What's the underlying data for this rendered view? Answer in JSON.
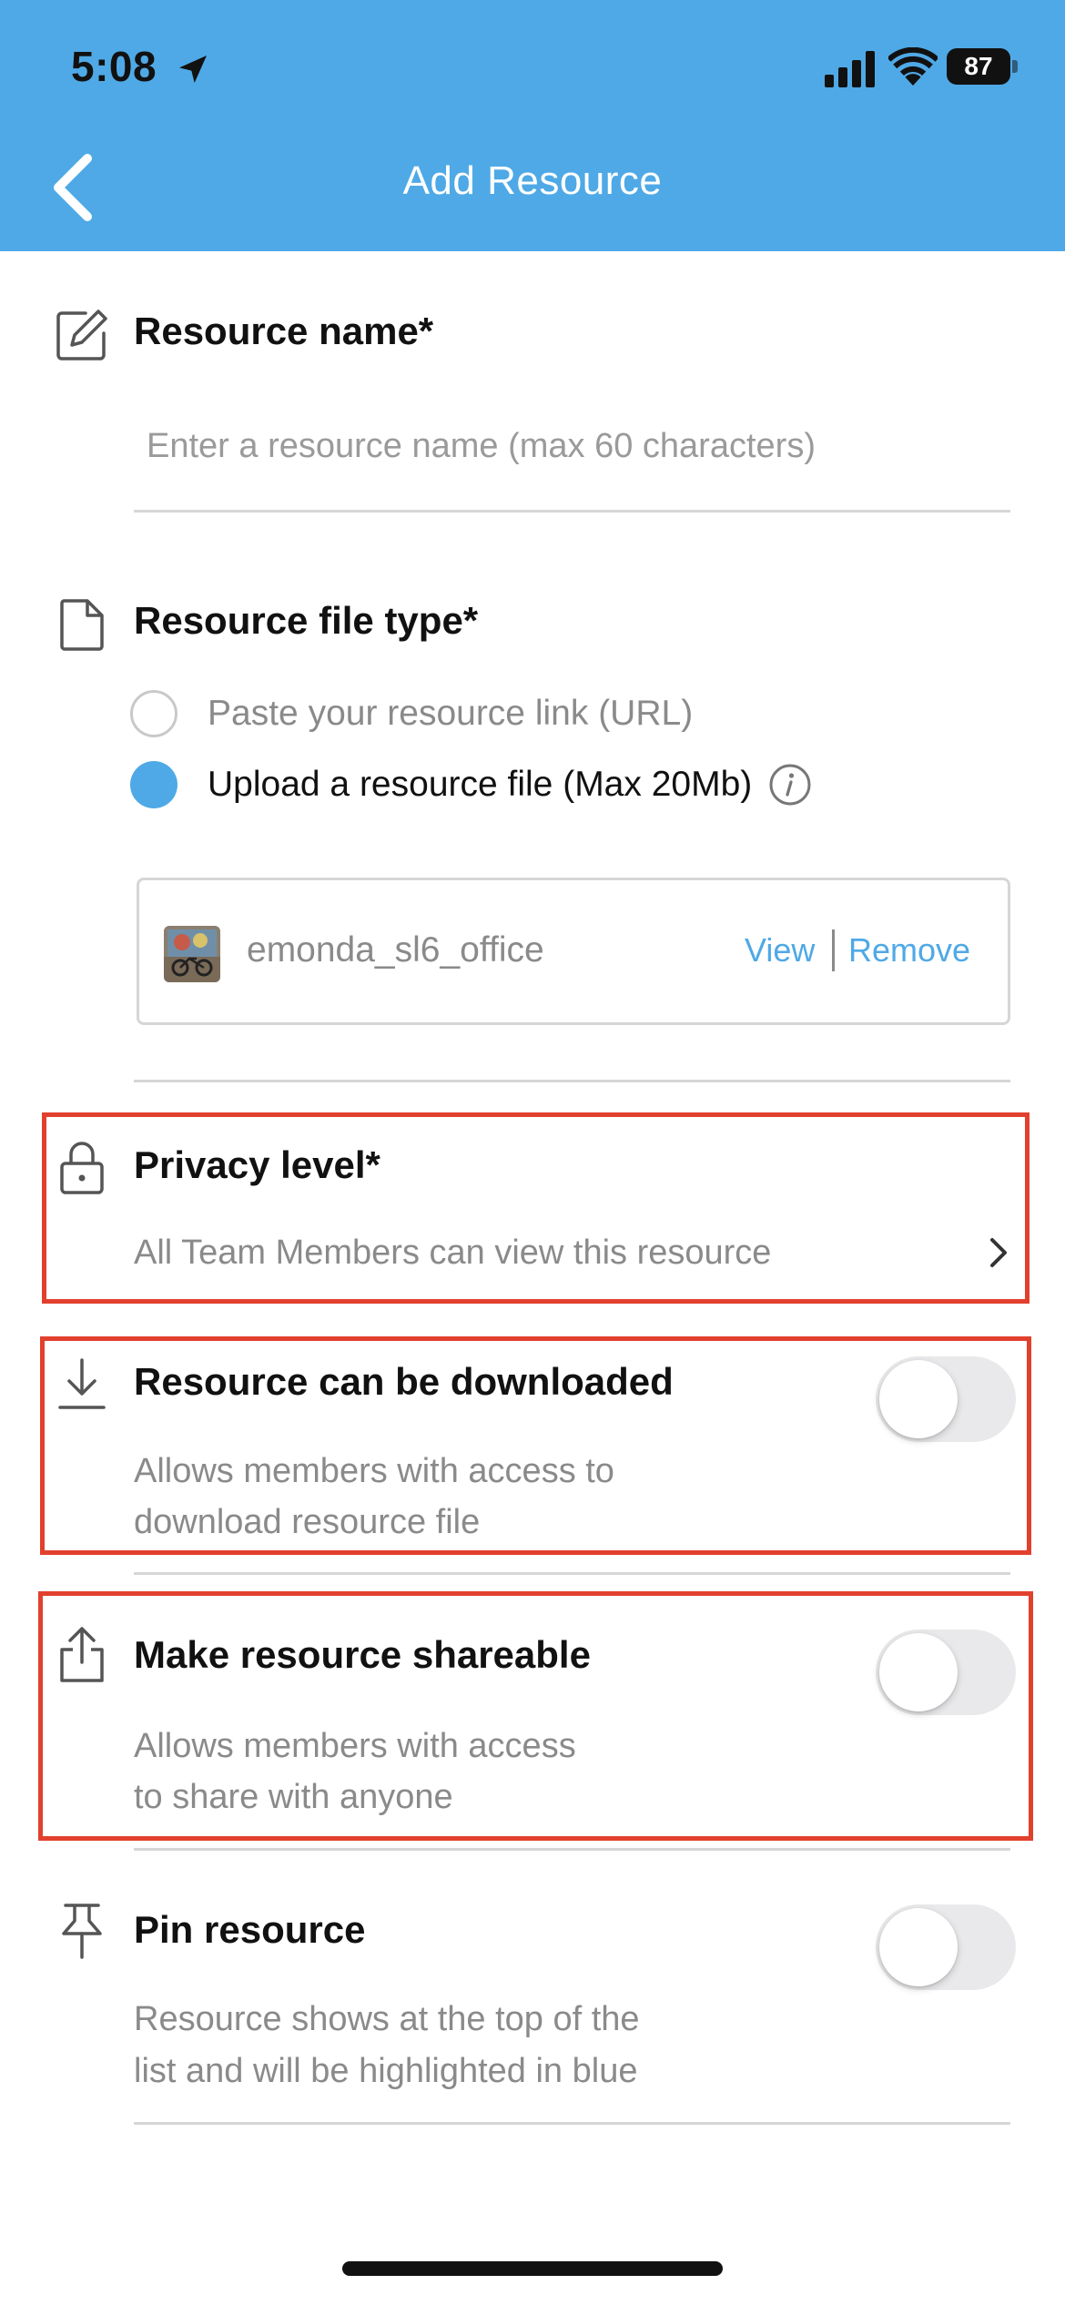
{
  "status_bar": {
    "time": "5:08",
    "battery": "87",
    "icons": [
      "location-arrow-icon",
      "cellular-signal-icon",
      "wifi-icon",
      "battery-icon"
    ]
  },
  "header": {
    "title": "Add Resource",
    "back_icon": "chevron-left-icon",
    "background_color": "#4fa9e6"
  },
  "resource_name": {
    "label": "Resource name*",
    "placeholder": "Enter a resource name (max 60 characters)",
    "value": "",
    "icon": "edit-icon"
  },
  "resource_file_type": {
    "label": "Resource file type*",
    "icon": "file-icon",
    "options": [
      {
        "label": "Paste your resource link (URL)",
        "selected": false
      },
      {
        "label": "Upload a resource file (Max 20Mb)",
        "selected": true
      }
    ],
    "file": {
      "name": "emonda_sl6_office",
      "view_label": "View",
      "remove_label": "Remove"
    }
  },
  "privacy": {
    "label": "Privacy level*",
    "value": "All Team Members can view this resource",
    "icon": "lock-icon"
  },
  "download": {
    "label": "Resource can be downloaded",
    "description_line1": "Allows members with access to",
    "description_line2": "download resource file",
    "enabled": false,
    "icon": "download-icon"
  },
  "share": {
    "label": "Make resource shareable",
    "description_line1": "Allows members with access",
    "description_line2": "to share with anyone",
    "enabled": false,
    "icon": "share-icon"
  },
  "pin": {
    "label": "Pin resource",
    "description_line1": "Resource shows at the top of the",
    "description_line2": "list and will be highlighted in blue",
    "enabled": false,
    "icon": "pin-icon"
  },
  "colors": {
    "accent": "#4fa9e6",
    "highlight_border": "#e2402e",
    "toggle_off": "#e9e9eb"
  }
}
